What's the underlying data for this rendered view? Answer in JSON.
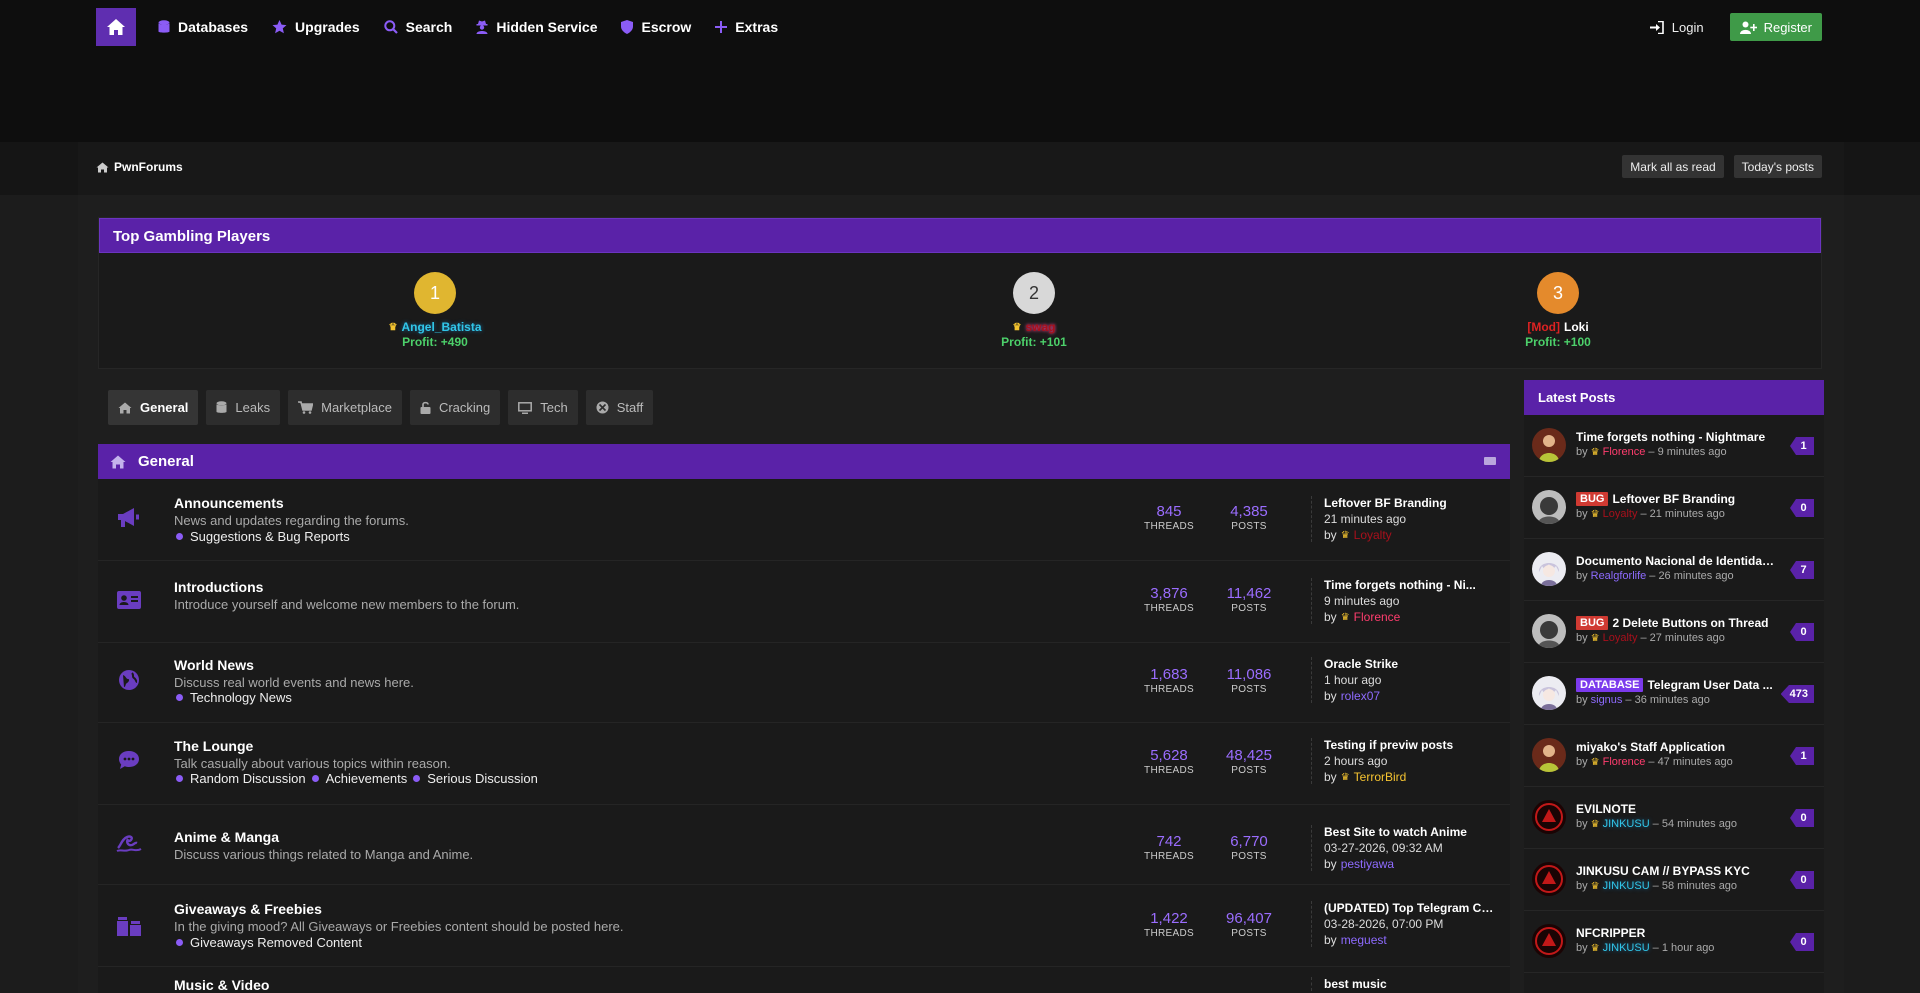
{
  "nav": {
    "items": [
      {
        "label": "Databases",
        "icon": "database-icon"
      },
      {
        "label": "Upgrades",
        "icon": "star-icon"
      },
      {
        "label": "Search",
        "icon": "search-icon"
      },
      {
        "label": "Hidden Service",
        "icon": "user-secret-icon"
      },
      {
        "label": "Escrow",
        "icon": "shield-icon"
      },
      {
        "label": "Extras",
        "icon": "plus-icon"
      }
    ],
    "login_label": "Login",
    "register_label": "Register"
  },
  "breadcrumb": {
    "home_label": "PwnForums"
  },
  "subbar": {
    "mark_read_label": "Mark all as read",
    "todays_posts_label": "Today's posts"
  },
  "gambling": {
    "title": "Top Gambling Players",
    "players": [
      {
        "rank": "1",
        "name": "Angel_Batista",
        "prefix": "",
        "profit": "Profit: +490",
        "medal_color": "#e0b630"
      },
      {
        "rank": "2",
        "name": "swag",
        "prefix": "",
        "profit": "Profit: +101",
        "medal_color": "#d8d8d8"
      },
      {
        "rank": "3",
        "name": "Loki",
        "prefix": "[Mod]",
        "profit": "Profit: +100",
        "medal_color": "#e48a2c"
      }
    ]
  },
  "tabs": [
    {
      "label": "General"
    },
    {
      "label": "Leaks"
    },
    {
      "label": "Marketplace"
    },
    {
      "label": "Cracking"
    },
    {
      "label": "Tech"
    },
    {
      "label": "Staff"
    }
  ],
  "category": {
    "title": "General"
  },
  "stat_labels": {
    "threads": "THREADS",
    "posts": "POSTS"
  },
  "forums": [
    {
      "title": "Announcements",
      "desc": "News and updates regarding the forums.",
      "subs": [
        "Suggestions & Bug Reports"
      ],
      "threads": "845",
      "posts": "4,385",
      "last_title": "Leftover BF Branding",
      "last_time": "21 minutes ago",
      "last_by": "by",
      "last_user": "Loyalty"
    },
    {
      "title": "Introductions",
      "desc": "Introduce yourself and welcome new members to the forum.",
      "subs": [],
      "threads": "3,876",
      "posts": "11,462",
      "last_title": "Time forgets nothing - Ni...",
      "last_time": "9 minutes ago",
      "last_by": "by",
      "last_user": "Florence"
    },
    {
      "title": "World News",
      "desc": "Discuss real world events and news here.",
      "subs": [
        "Technology News"
      ],
      "threads": "1,683",
      "posts": "11,086",
      "last_title": "Oracle Strike",
      "last_time": "1 hour ago",
      "last_by": "by",
      "last_user": "rolex07"
    },
    {
      "title": "The Lounge",
      "desc": "Talk casually about various topics within reason.",
      "subs": [
        "Random Discussion",
        "Achievements",
        "Serious Discussion"
      ],
      "threads": "5,628",
      "posts": "48,425",
      "last_title": "Testing if previw posts",
      "last_time": "2 hours ago",
      "last_by": "by",
      "last_user": "TerrorBird"
    },
    {
      "title": "Anime & Manga",
      "desc": "Discuss various things related to Manga and Anime.",
      "subs": [],
      "threads": "742",
      "posts": "6,770",
      "last_title": "Best Site to watch Anime",
      "last_time": "03-27-2026, 09:32 AM",
      "last_by": "by",
      "last_user": "pestiyawa"
    },
    {
      "title": "Giveaways & Freebies",
      "desc": "In the giving mood? All Giveaways or Freebies content should be posted here.",
      "subs": [
        "Giveaways Removed Content"
      ],
      "threads": "1,422",
      "posts": "96,407",
      "last_title": "(UPDATED) Top Telegram Ch...",
      "last_time": "03-28-2026, 07:00 PM",
      "last_by": "by",
      "last_user": "meguest"
    },
    {
      "title": "Music & Video",
      "desc": "",
      "subs": [],
      "threads": "",
      "posts": "",
      "last_title": "best music",
      "last_time": "",
      "last_by": "",
      "last_user": ""
    }
  ],
  "latest": {
    "title": "Latest Posts",
    "by_label": "by",
    "posts": [
      {
        "prefix": "",
        "title": "Time forgets nothing - Nightmare",
        "user": "Florence",
        "time": "– 9 minutes ago",
        "count": "1"
      },
      {
        "prefix": "BUG",
        "title": "Leftover BF Branding",
        "user": "Loyalty",
        "time": "– 21 minutes ago",
        "count": "0"
      },
      {
        "prefix": "",
        "title": "Documento Nacional de Identidad (...",
        "user": "Realgforlife",
        "time": "– 26 minutes ago",
        "count": "7"
      },
      {
        "prefix": "BUG",
        "title": "2 Delete Buttons on Thread",
        "user": "Loyalty",
        "time": "– 27 minutes ago",
        "count": "0"
      },
      {
        "prefix": "DATABASE",
        "title": "Telegram User Data ...",
        "user": "signus",
        "time": "– 36 minutes ago",
        "count": "473"
      },
      {
        "prefix": "",
        "title": "miyako's Staff Application",
        "user": "Florence",
        "time": "– 47 minutes ago",
        "count": "1"
      },
      {
        "prefix": "",
        "title": "EVILNOTE",
        "user": "JINKUSU",
        "time": "– 54 minutes ago",
        "count": "0"
      },
      {
        "prefix": "",
        "title": "JINKUSU CAM // BYPASS KYC",
        "user": "JINKUSU",
        "time": "– 58 minutes ago",
        "count": "0"
      },
      {
        "prefix": "",
        "title": "NFCRIPPER",
        "user": "JINKUSU",
        "time": "– 1 hour ago",
        "count": "0"
      }
    ]
  }
}
